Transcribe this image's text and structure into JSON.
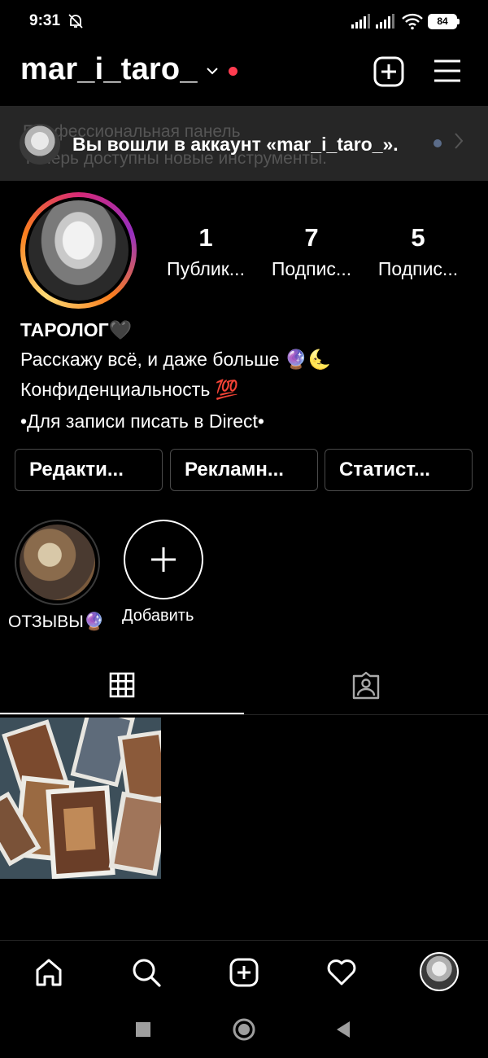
{
  "status_bar": {
    "time": "9:31",
    "battery": "84"
  },
  "header": {
    "username": "mar_i_taro_"
  },
  "toast": {
    "underlying_line1": "Профессиональная панель",
    "underlying_line2": "Теперь доступны новые инструменты.",
    "message": "Вы вошли в аккаунт «mar_i_taro_»."
  },
  "profile": {
    "stats": [
      {
        "value": "1",
        "label": "Публик..."
      },
      {
        "value": "7",
        "label": "Подпис..."
      },
      {
        "value": "5",
        "label": "Подпис..."
      }
    ],
    "bio": {
      "name": "ТАРОЛОГ🖤",
      "line1": "Расскажу всё, и даже больше 🔮🌜",
      "line2": "Конфиденциальность 💯",
      "line3": "•Для записи писать в Direct•"
    },
    "buttons": [
      "Редакти...",
      "Рекламн...",
      "Статист..."
    ]
  },
  "highlights": [
    {
      "label": "ОТЗЫВЫ🔮"
    },
    {
      "label": "Добавить"
    }
  ],
  "colors": {
    "background": "#000000",
    "notification_dot": "#ff3c50",
    "toast_bg": "#262626",
    "button_border": "#4a4a4a"
  },
  "icons": {
    "header": [
      "chevron-down-icon",
      "add-post-icon",
      "menu-icon"
    ],
    "tabs": [
      "grid-icon",
      "tagged-icon"
    ],
    "bottom_nav": [
      "home-icon",
      "search-icon",
      "new-post-icon",
      "heart-icon",
      "profile-avatar"
    ],
    "system_nav": [
      "recent-apps-icon",
      "home-button-icon",
      "back-icon"
    ]
  }
}
